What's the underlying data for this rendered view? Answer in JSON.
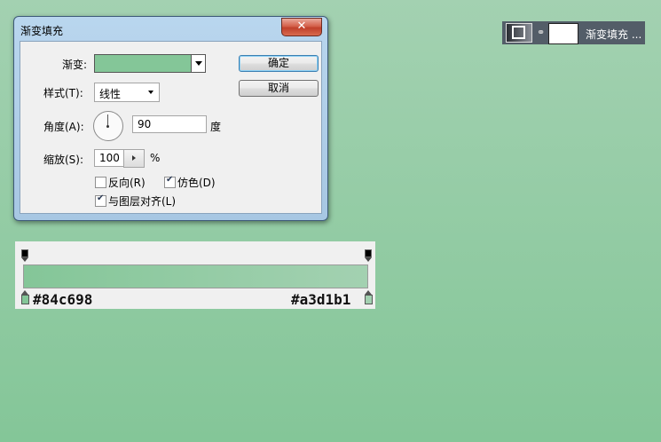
{
  "dialog": {
    "title": "渐变填充",
    "close_label": "✕",
    "gradient_label": "渐变:",
    "gradient_swatch_color": "#84c698",
    "style_label": "样式(T):",
    "style_value": "线性",
    "angle_label": "角度(A):",
    "angle_value": "90",
    "angle_unit": "度",
    "scale_label": "缩放(S):",
    "scale_value": "100",
    "scale_unit": "%",
    "reverse_label": "反向(R)",
    "reverse_checked": false,
    "dither_label": "仿色(D)",
    "dither_checked": true,
    "align_label": "与图层对齐(L)",
    "align_checked": true,
    "ok_label": "确定",
    "cancel_label": "取消"
  },
  "gradient_preview": {
    "start_color_hex": "#84c698",
    "end_color_hex": "#a3d1b1",
    "start_label": "#84c698",
    "end_label": "#a3d1b1"
  },
  "layer": {
    "name": "渐变填充 ...",
    "link_icon": "chain-link-icon"
  }
}
